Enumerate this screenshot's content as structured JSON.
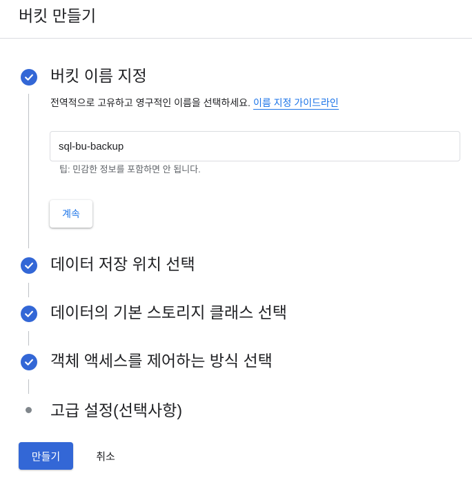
{
  "header": {
    "title": "버킷 만들기"
  },
  "steps": [
    {
      "title": "버킷 이름 지정",
      "status": "complete",
      "description": "전역적으로 고유하고 영구적인 이름을 선택하세요.",
      "guide_link": "이름 지정 가이드라인",
      "input_value": "sql-bu-backup",
      "hint": "팁: 민감한 정보를 포함하면 안 됩니다.",
      "continue_label": "계속"
    },
    {
      "title": "데이터 저장 위치 선택",
      "status": "complete"
    },
    {
      "title": "데이터의 기본 스토리지 클래스 선택",
      "status": "complete"
    },
    {
      "title": "객체 액세스를 제어하는 방식 선택",
      "status": "complete"
    },
    {
      "title": "고급 설정(선택사항)",
      "status": "pending"
    }
  ],
  "actions": {
    "create_label": "만들기",
    "cancel_label": "취소"
  },
  "colors": {
    "accent": "#3367d6",
    "link": "#1a73e8",
    "divider": "#dadce0"
  },
  "icons": {
    "complete": "check-circle-icon",
    "pending": "bullet-icon"
  }
}
